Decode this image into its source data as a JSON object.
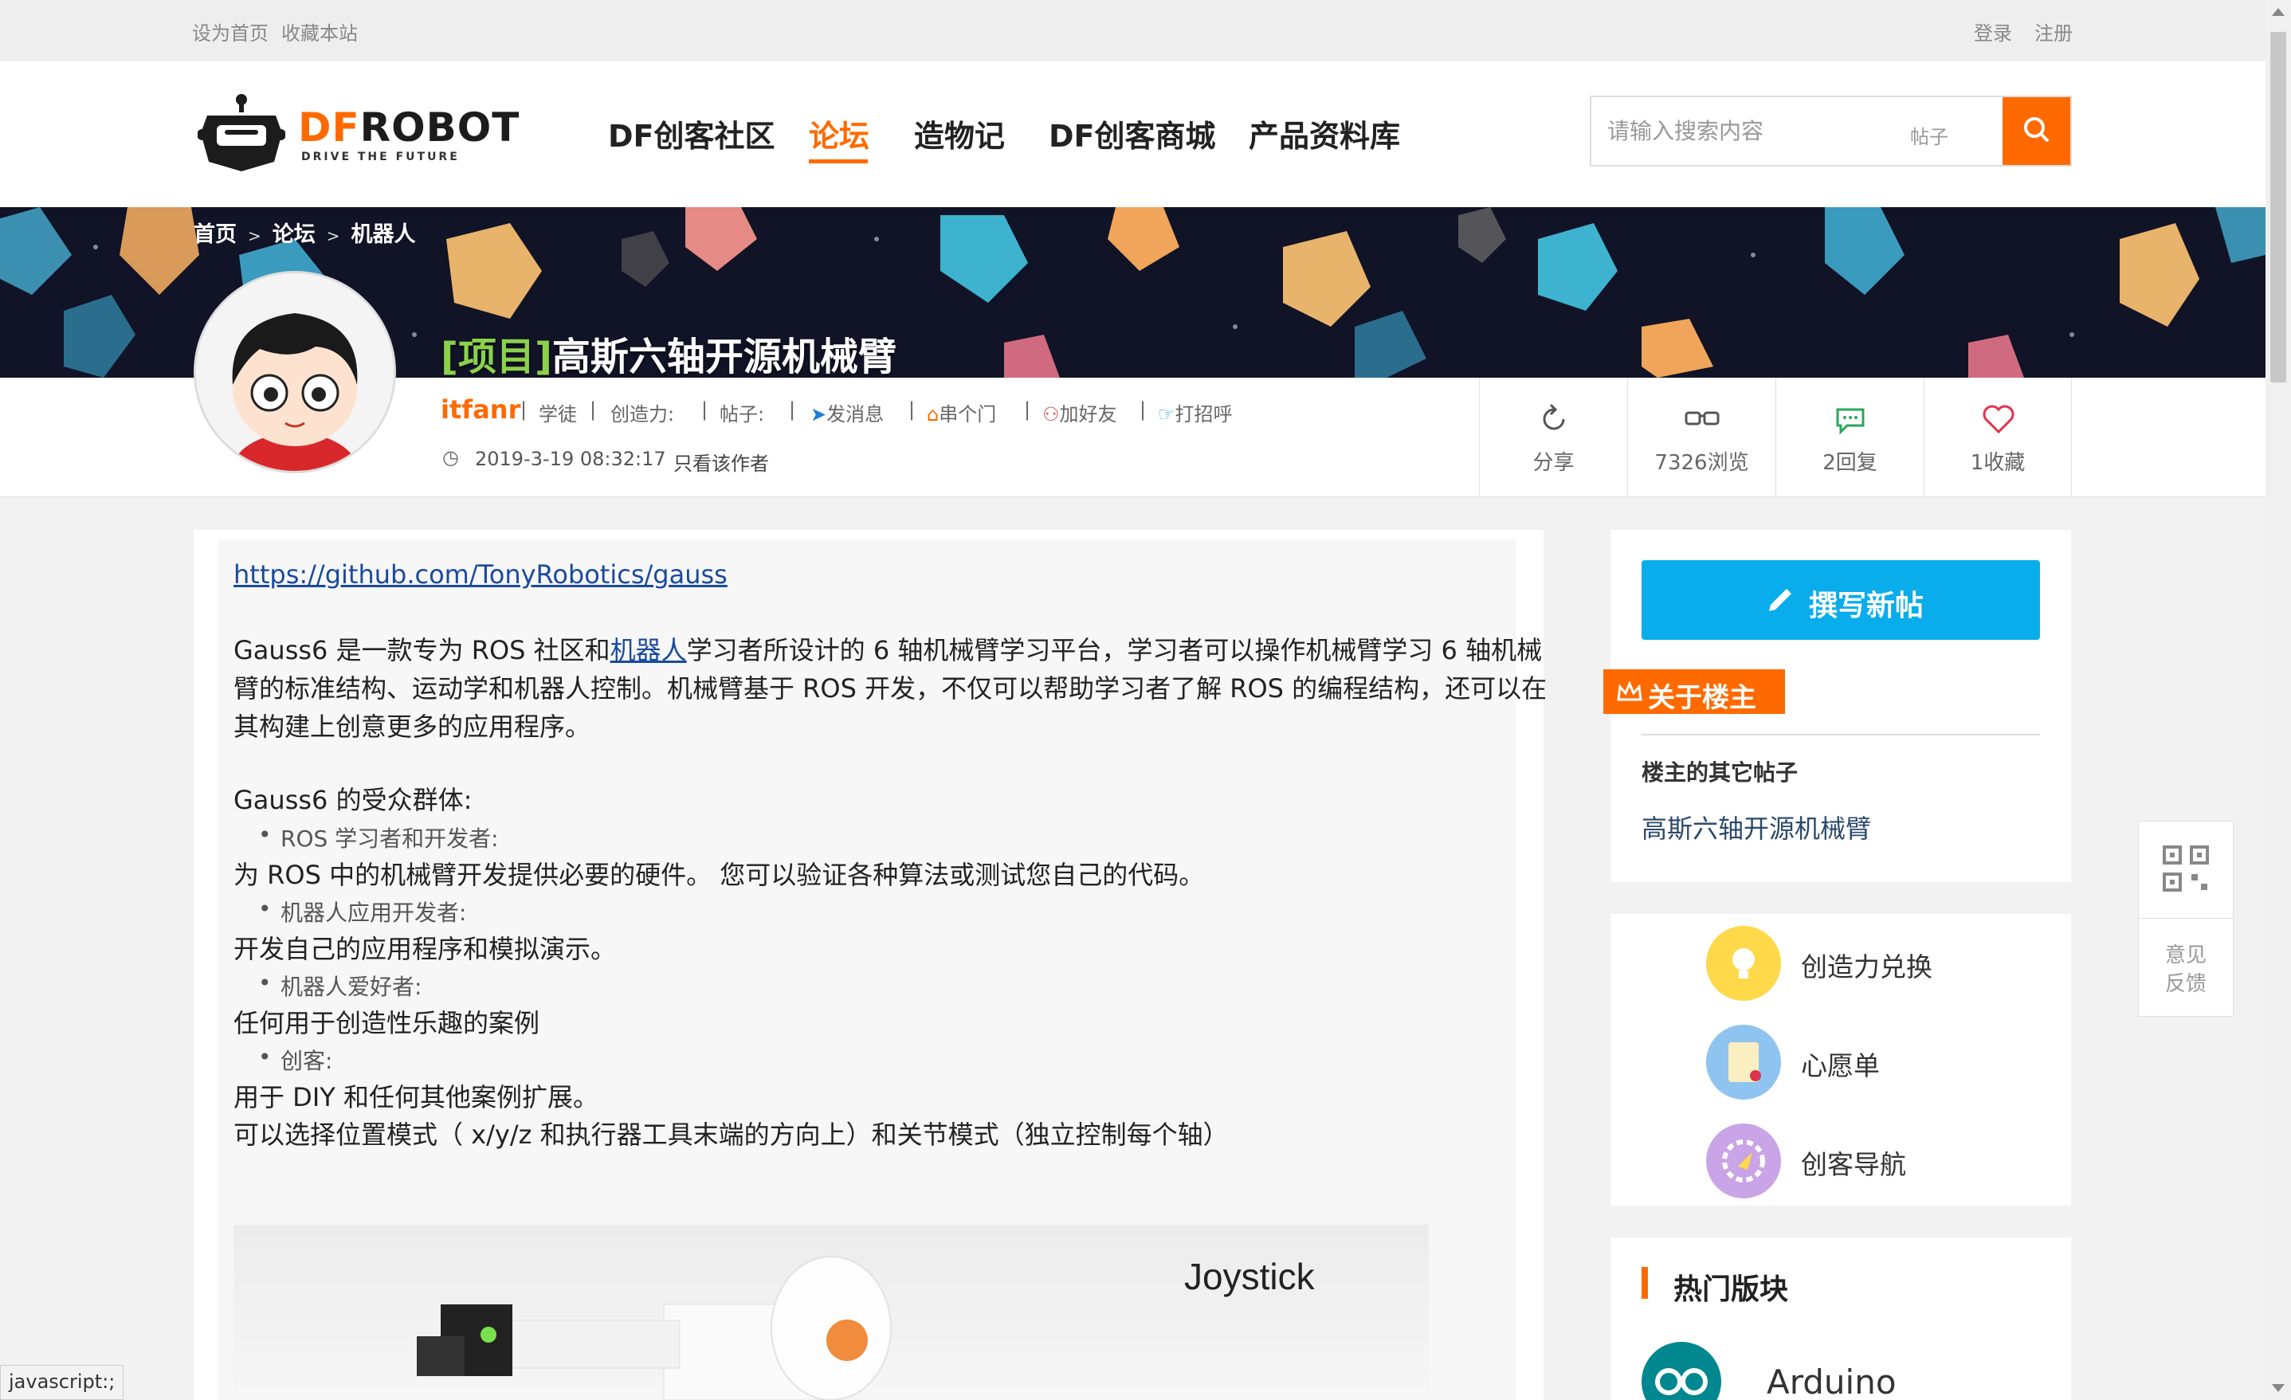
{
  "topbar": {
    "set_home": "设为首页",
    "bookmark": "收藏本站",
    "login": "登录",
    "register": "注册"
  },
  "logo": {
    "df": "DF",
    "robot": "ROBOT",
    "slogan": "DRIVE THE FUTURE"
  },
  "nav": [
    {
      "label": "DF创客社区"
    },
    {
      "label": "论坛",
      "active": true
    },
    {
      "label": "造物记"
    },
    {
      "label": "DF创客商城"
    },
    {
      "label": "产品资料库"
    }
  ],
  "search": {
    "placeholder": "请输入搜索内容",
    "scope": "帖子",
    "icon": "search-icon"
  },
  "breadcrumb": {
    "home": "首页",
    "forum": "论坛",
    "section": "机器人",
    "sep": ">"
  },
  "post": {
    "tag": "[项目]",
    "title": "高斯六轴开源机械臂",
    "author": "itfanr",
    "rank": "学徒",
    "creativity_label": "创造力:",
    "posts_label": "帖子:",
    "actions": {
      "message": "发消息",
      "visit": "串个门",
      "add_friend": "加好友",
      "greet": "打招呼"
    },
    "datetime": "2019-3-19 08:32:17",
    "only_author": "只看该作者"
  },
  "stats": {
    "share": "分享",
    "views": "7326浏览",
    "replies": "2回复",
    "favorites": "1收藏"
  },
  "content": {
    "link": "https://github.com/TonyRobotics/gauss",
    "para1_line1_a": "Gauss6 是一款专为 ROS 社区和",
    "para1_link": "机器人",
    "para1_line1_b": "学习者所设计的 6 轴机械臂学习平台，学习者可以操作机械臂学习 6 轴机械",
    "para1_line2": "臂的标准结构、运动学和机器人控制。机械臂基于 ROS 开发，不仅可以帮助学习者了解 ROS 的编程结构，还可以在",
    "para1_line3": "其构建上创意更多的应用程序。",
    "audience_title": "Gauss6 的受众群体:",
    "b1": "ROS 学习者和开发者:",
    "b1_text": "为 ROS 中的机械臂开发提供必要的硬件。 您可以验证各种算法或测试您自己的代码。",
    "b2": "机器人应用开发者:",
    "b2_text": "开发自己的应用程序和模拟演示。",
    "b3": "机器人爱好者:",
    "b3_text": "任何用于创造性乐趣的案例",
    "b4": "创客:",
    "b4_text": "用于 DIY 和任何其他案例扩展。",
    "mode_text": "可以选择位置模式（ x/y/z 和执行器工具末端的方向上）和关节模式（独立控制每个轴）",
    "photo_label": "Joystick"
  },
  "sidebar": {
    "new_post": "撰写新帖",
    "about_owner": "关于楼主",
    "other_posts_title": "楼主的其它帖子",
    "other_post": "高斯六轴开源机械臂",
    "tools": [
      {
        "label": "创造力兑换",
        "color": "#ffd94a"
      },
      {
        "label": "心愿单",
        "color": "#8fc4f0"
      },
      {
        "label": "创客导航",
        "color": "#c9a4e6"
      }
    ],
    "hot_title": "热门版块",
    "hot_item": "Arduino"
  },
  "float": {
    "feedback_1": "意见",
    "feedback_2": "反馈"
  },
  "status_bar": "javascript:;",
  "colors": {
    "accent": "#ff6a00",
    "button_blue": "#0aadec",
    "link": "#1a4a9c"
  }
}
